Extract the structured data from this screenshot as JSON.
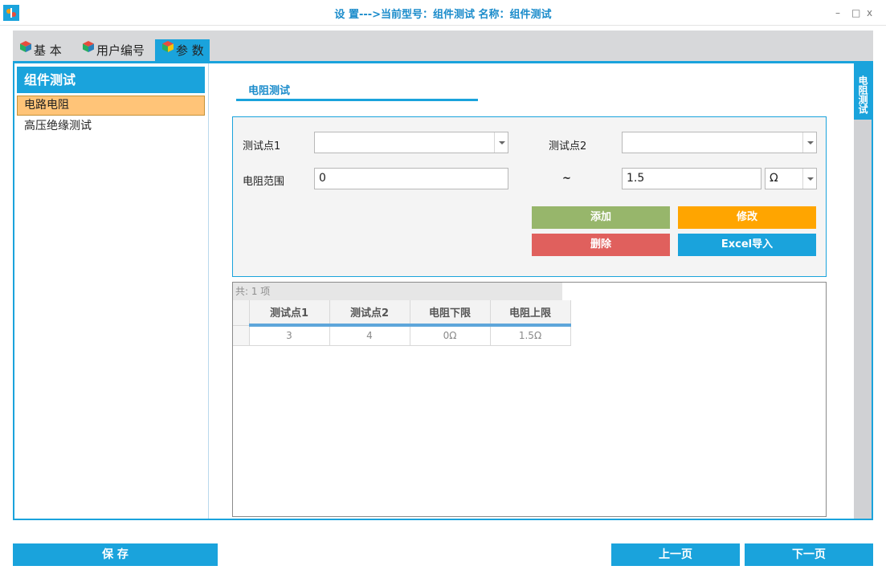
{
  "window": {
    "title": "设 置--->当前型号：组件测试 名称：组件测试",
    "minimize": "–",
    "maximize": "□",
    "close": "x"
  },
  "tabs": [
    {
      "label": "基 本",
      "icon": "colored-cube-icon"
    },
    {
      "label": "用户编号",
      "icon": "colored-cube-icon"
    },
    {
      "label": "参 数",
      "icon": "colored-cube-icon",
      "active": true
    }
  ],
  "sidebar": {
    "header": "组件测试",
    "items": [
      {
        "label": "电路电阻",
        "selected": true
      },
      {
        "label": "高压绝缘测试",
        "selected": false
      }
    ]
  },
  "side_tab": "电阻测试",
  "section": {
    "title": "电阻测试"
  },
  "form": {
    "point1_label": "测试点1",
    "point1_value": "",
    "point2_label": "测试点2",
    "point2_value": "",
    "range_label": "电阻范围",
    "range_min": "0",
    "range_sep": "~",
    "range_max": "1.5",
    "unit": "Ω"
  },
  "buttons": {
    "add": "添加",
    "edit": "修改",
    "delete": "删除",
    "excel": "Excel导入"
  },
  "grid": {
    "count_text": "共: 1 项",
    "columns": [
      "测试点1",
      "测试点2",
      "电阻下限",
      "电阻上限"
    ],
    "rows": [
      [
        "3",
        "4",
        "0Ω",
        "1.5Ω"
      ]
    ]
  },
  "footer": {
    "save": "保 存",
    "prev": "上一页",
    "next": "下一页"
  },
  "colors": {
    "accent": "#1aa3dc",
    "selected_item": "#ffc478",
    "add_button": "#97b66b",
    "edit_button": "#ffa500",
    "delete_button": "#e0605d",
    "excel_button": "#1aa3dc"
  }
}
